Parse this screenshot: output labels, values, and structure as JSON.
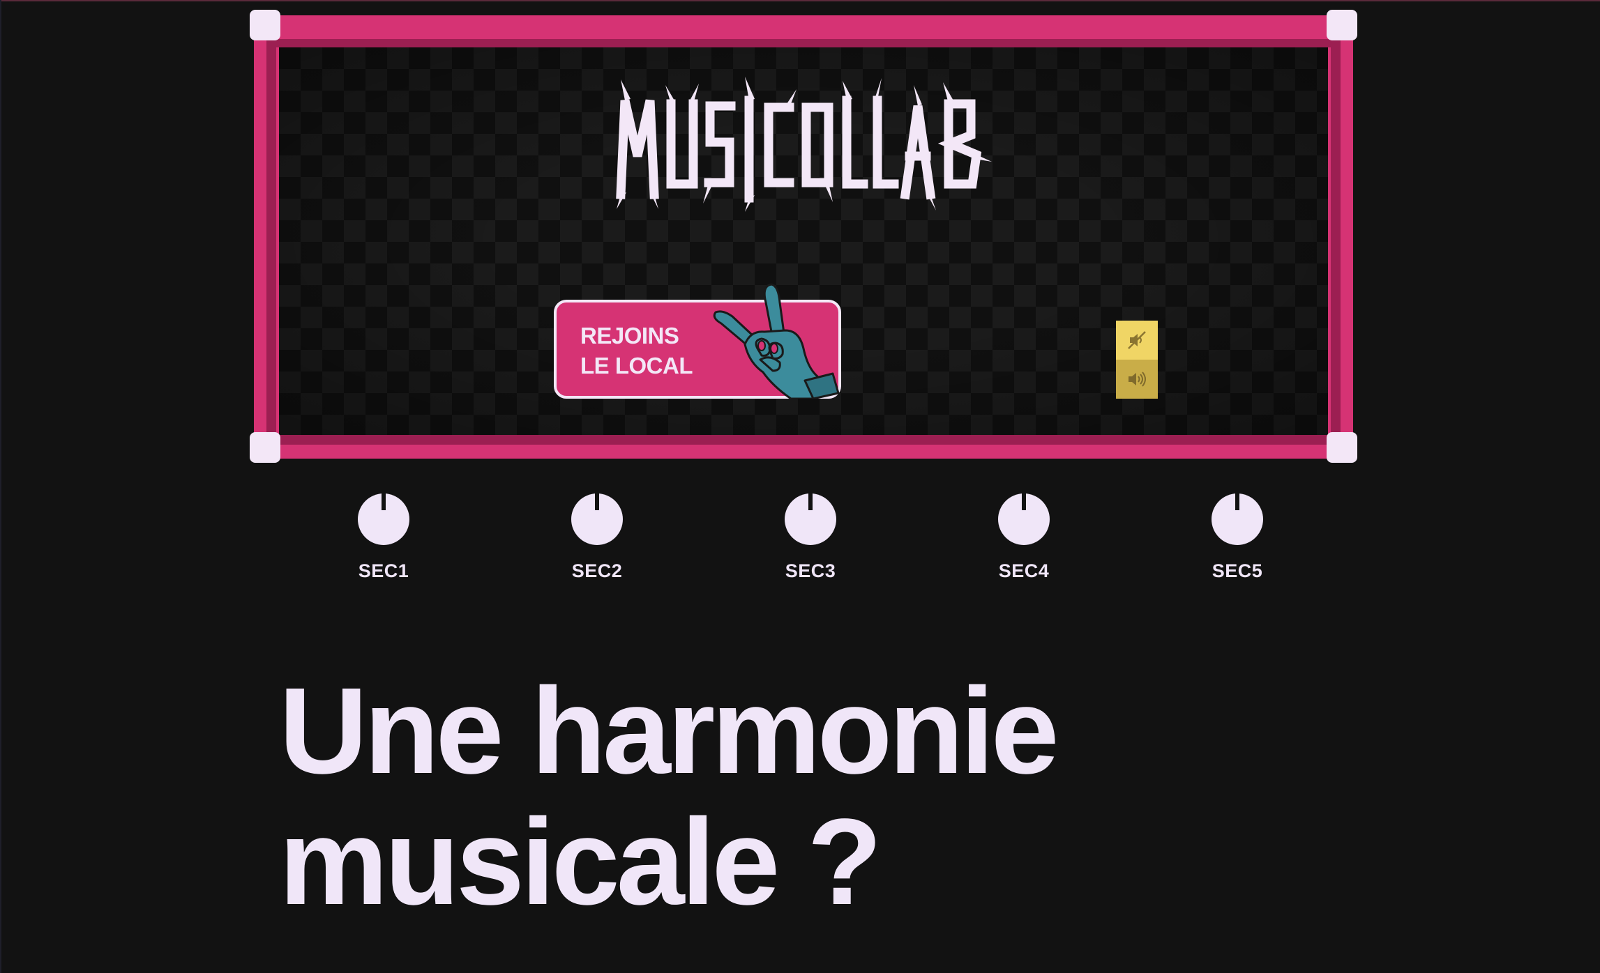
{
  "brand": {
    "logo_text": "MUSICOLLAB"
  },
  "cta": {
    "line1": "REJOINS",
    "line2": "LE LOCAL",
    "icon": "rock-hand-icon"
  },
  "sound": {
    "mute_icon": "speaker-muted-icon",
    "on_icon": "speaker-on-icon"
  },
  "knobs": [
    {
      "label": "SEC1"
    },
    {
      "label": "SEC2"
    },
    {
      "label": "SEC3"
    },
    {
      "label": "SEC4"
    },
    {
      "label": "SEC5"
    }
  ],
  "headline": {
    "line1": "Une harmonie",
    "line2": "musicale ?"
  },
  "colors": {
    "background": "#121212",
    "frame_pink": "#d63374",
    "frame_dark_pink": "#9c1f52",
    "light": "#f0e6f8",
    "sound_yellow": "#f0d565",
    "hand_teal": "#3c8c9c"
  }
}
